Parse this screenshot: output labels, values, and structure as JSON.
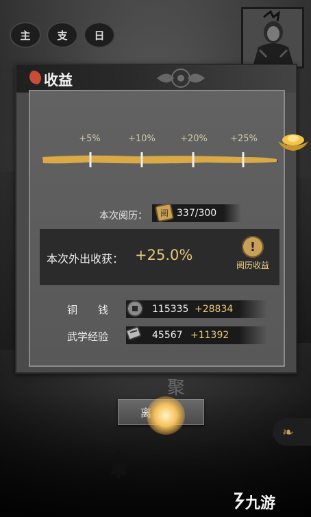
{
  "top_tags": [
    "主",
    "支",
    "日"
  ],
  "panel": {
    "title": "收益"
  },
  "milestones": [
    {
      "label": "+5%"
    },
    {
      "label": "+10%"
    },
    {
      "label": "+20%"
    },
    {
      "label": "+25%"
    }
  ],
  "progress": {
    "experience_current": 337,
    "experience_max": 300,
    "fill_fraction": 1.0
  },
  "experience": {
    "label": "本次阅历：",
    "value": "337/300"
  },
  "gain": {
    "label": "本次外出收获：",
    "value": "+25.0%",
    "button_label": "阅历收益",
    "button_icon": "exclamation-icon"
  },
  "resources": [
    {
      "label": "铜　　钱",
      "value": "115335",
      "bonus": "+28834",
      "icon": "coin-icon"
    },
    {
      "label": "武学经验",
      "value": "45567",
      "bonus": "+11392",
      "icon": "scroll-icon"
    }
  ],
  "faint_char": "聚",
  "leave_button": "离开",
  "watermark": "九游",
  "colors": {
    "gold": "#e7c87a",
    "panel": "#4a4a4a",
    "accent_red": "#c94c38"
  }
}
